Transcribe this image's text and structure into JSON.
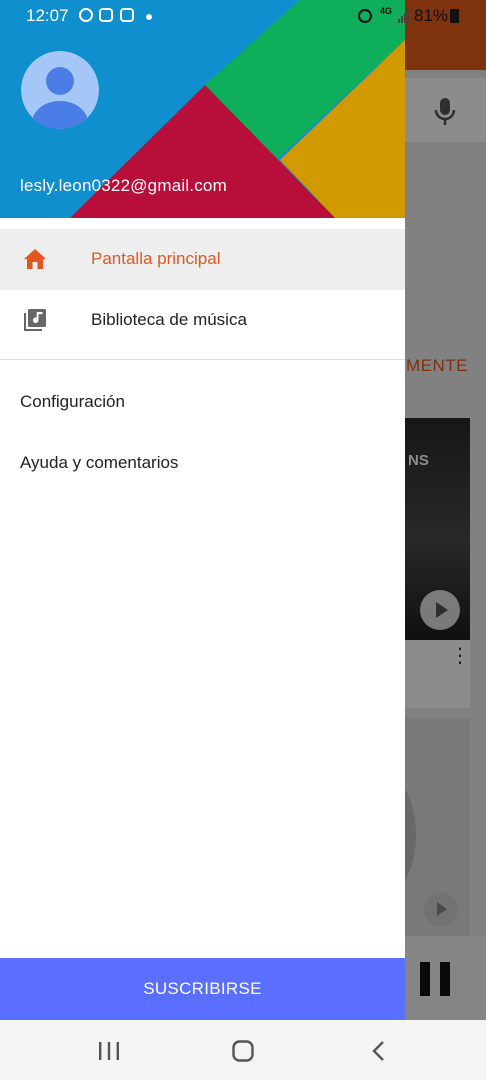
{
  "status_bar": {
    "time": "12:07",
    "battery": "81%",
    "network": "4G"
  },
  "drawer": {
    "account_email": "lesly.leon0322@gmail.com",
    "nav_items": [
      {
        "label": "Pantalla principal",
        "icon": "home-icon",
        "selected": true
      },
      {
        "label": "Biblioteca de música",
        "icon": "music-library-icon",
        "selected": false
      }
    ],
    "menu_links": [
      {
        "label": "Configuración"
      },
      {
        "label": "Ayuda y comentarios"
      }
    ],
    "subscribe_label": "SUSCRIBIRSE"
  },
  "background_app": {
    "section_label": "MENTE",
    "card_text": "NS"
  },
  "colors": {
    "accent": "#e2561f",
    "subscribe": "#5a6eff",
    "header_blue": "#0f8fce",
    "header_green": "#0fae5a",
    "header_red": "#b80f3a",
    "header_gold": "#d09a00"
  }
}
